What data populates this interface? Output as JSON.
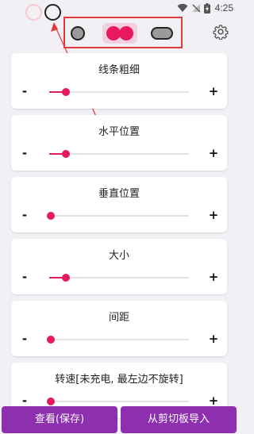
{
  "status_bar": {
    "time": "4:25",
    "icons": [
      "wifi-icon",
      "signal-off-icon",
      "battery-charging-icon"
    ]
  },
  "style_selector": {
    "options": [
      "single-dot",
      "double-dot",
      "pill"
    ],
    "selected": "double-dot"
  },
  "colors": {
    "accent": "#e8195c",
    "button_bg": "#8e2fb0",
    "annotation": "#e03a3a"
  },
  "sliders": [
    {
      "label": "线条粗细",
      "minus": "-",
      "plus": "+",
      "value": 0.12
    },
    {
      "label": "水平位置",
      "minus": "-",
      "plus": "+",
      "value": 0.12
    },
    {
      "label": "垂直位置",
      "minus": "-",
      "plus": "+",
      "value": 0.01
    },
    {
      "label": "大小",
      "minus": "-",
      "plus": "+",
      "value": 0.12
    },
    {
      "label": "间距",
      "minus": "-",
      "plus": "+",
      "value": 0.01
    },
    {
      "label": "转速[未充电, 最左边不旋转]",
      "minus": "-",
      "plus": "+",
      "value": 0.01
    }
  ],
  "buttons": {
    "view_save": "查看(保存)",
    "import_clipboard": "从剪切板导入"
  }
}
